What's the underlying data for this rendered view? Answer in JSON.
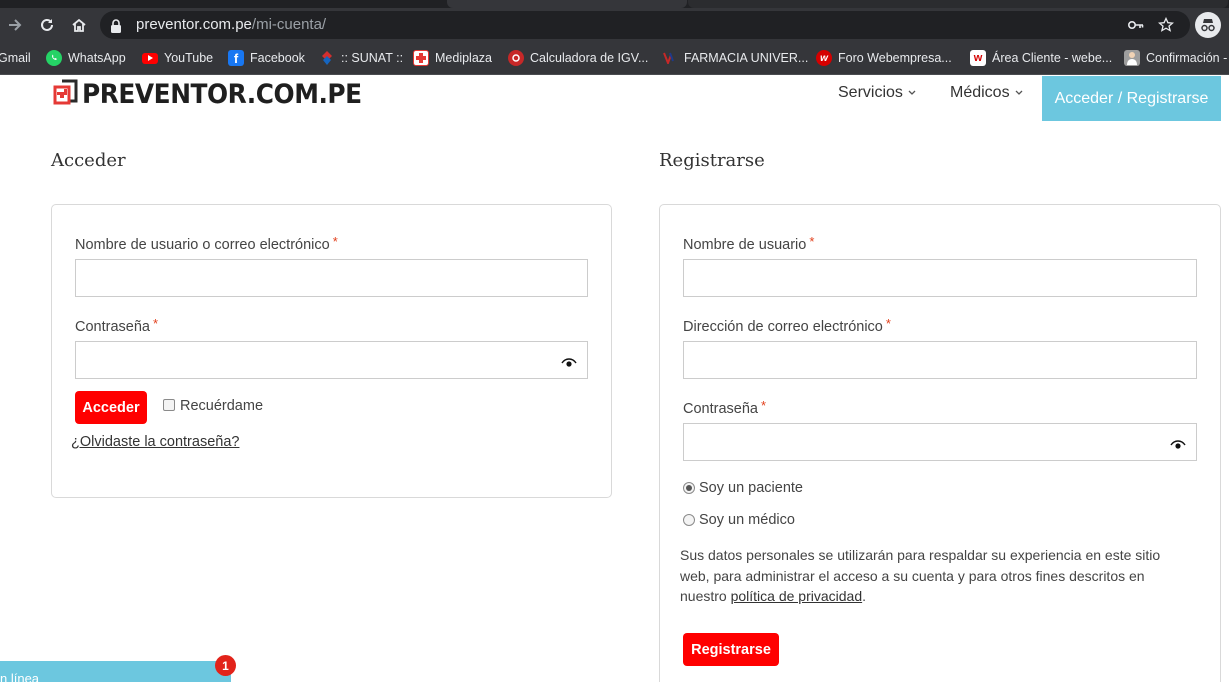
{
  "browser": {
    "url_host": "preventor.com.pe",
    "url_path": "/mi-cuenta/",
    "bookmarks": [
      {
        "label": "Gmail",
        "icon": "gmail-icon",
        "color": "#35363a"
      },
      {
        "label": "WhatsApp",
        "icon": "whatsapp-icon",
        "color": "#25d366"
      },
      {
        "label": "YouTube",
        "icon": "youtube-icon",
        "color": "#ff0000"
      },
      {
        "label": "Facebook",
        "icon": "facebook-icon",
        "color": "#1877f2"
      },
      {
        "label": ":: SUNAT ::",
        "icon": "sunat-icon",
        "color": "#d32f2f"
      },
      {
        "label": "Mediplaza",
        "icon": "mediplaza-icon",
        "color": "#e53935"
      },
      {
        "label": "Calculadora de IGV...",
        "icon": "calculadora-icon",
        "color": "#c62828"
      },
      {
        "label": "FARMACIA UNIVER...",
        "icon": "farmacia-icon",
        "color": "#1e3a8a"
      },
      {
        "label": "Foro Webempresa...",
        "icon": "foro-icon",
        "color": "#d50000"
      },
      {
        "label": "Área Cliente - webe...",
        "icon": "webempresa-icon",
        "color": "#ffffff"
      },
      {
        "label": "Confirmación -",
        "icon": "confirmacion-icon",
        "color": "#9e9e9e"
      }
    ]
  },
  "site": {
    "logo_text": "PREVENTOR.COM.PE",
    "menu": [
      {
        "label": "Servicios"
      },
      {
        "label": "Médicos"
      }
    ],
    "cta_label": "Acceder / Registrarse",
    "accent_color": "#6cc7df",
    "button_color": "#ff0000"
  },
  "login": {
    "title": "Acceder",
    "username_label": "Nombre de usuario o correo electrónico",
    "username_value": "",
    "password_label": "Contraseña",
    "password_value": "",
    "required_mark": "*",
    "submit_label": "Acceder",
    "remember_label": "Recuérdame",
    "remember_checked": false,
    "forgot_label": "¿Olvidaste la contraseña?"
  },
  "register": {
    "title": "Registrarse",
    "username_label": "Nombre de usuario",
    "username_value": "",
    "email_label": "Dirección de correo electrónico",
    "email_value": "",
    "password_label": "Contraseña",
    "password_value": "",
    "required_mark": "*",
    "role_patient_label": "Soy un paciente",
    "role_doctor_label": "Soy un médico",
    "selected_role": "patient",
    "privacy_text_before": "Sus datos personales se utilizarán para respaldar su experiencia en este sitio web, para administrar el acceso a su cuenta y para otros fines descritos en nuestro ",
    "privacy_link": "política de privacidad",
    "privacy_text_after": ".",
    "submit_label": "Registrarse"
  },
  "chat": {
    "label": "n línea",
    "badge_count": "1"
  }
}
